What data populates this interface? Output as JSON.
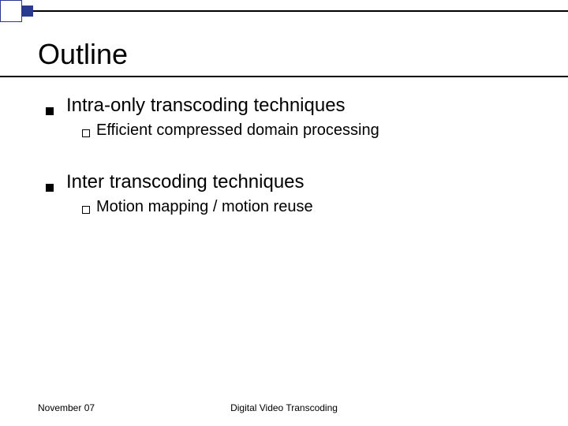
{
  "slide": {
    "title": "Outline",
    "items": [
      {
        "text": "Intra-only transcoding techniques",
        "sub": {
          "text": "Efficient compressed domain processing"
        }
      },
      {
        "text": "Inter transcoding techniques",
        "sub": {
          "text": "Motion mapping / motion reuse"
        }
      }
    ]
  },
  "footer": {
    "date": "November 07",
    "title": "Digital Video Transcoding"
  }
}
